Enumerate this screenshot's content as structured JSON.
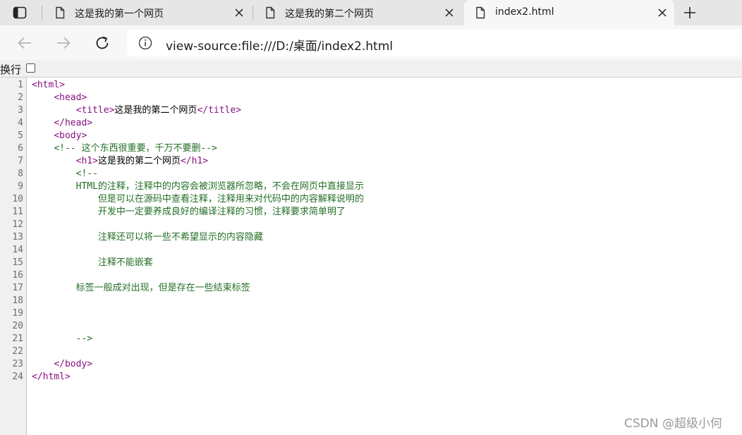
{
  "tabs": [
    {
      "title": "这是我的第一个网页",
      "active": false
    },
    {
      "title": "这是我的第二个网页",
      "active": false
    },
    {
      "title": "index2.html",
      "active": true
    }
  ],
  "address": {
    "url": "view-source:file:///D:/桌面/index2.html"
  },
  "wrap": {
    "label": "换行",
    "checked": false
  },
  "source": {
    "line_numbers": [
      "1",
      "2",
      "3",
      "4",
      "5",
      "6",
      "7",
      "8",
      "9",
      "10",
      "11",
      "12",
      "13",
      "14",
      "15",
      "16",
      "17",
      "18",
      "19",
      "20",
      "21",
      "22",
      "23",
      "24"
    ],
    "lines": [
      [
        {
          "t": "<html>",
          "c": "tag"
        }
      ],
      [
        {
          "t": "    ",
          "c": "txt"
        },
        {
          "t": "<head>",
          "c": "tag"
        }
      ],
      [
        {
          "t": "        ",
          "c": "txt"
        },
        {
          "t": "<title>",
          "c": "tag"
        },
        {
          "t": "这是我的第二个网页",
          "c": "txt"
        },
        {
          "t": "</title>",
          "c": "tag"
        }
      ],
      [
        {
          "t": "    ",
          "c": "txt"
        },
        {
          "t": "</head>",
          "c": "tag"
        }
      ],
      [
        {
          "t": "    ",
          "c": "txt"
        },
        {
          "t": "<body>",
          "c": "tag"
        }
      ],
      [
        {
          "t": "    ",
          "c": "txt"
        },
        {
          "t": "<!-- 这个东西很重要，千万不要删-->",
          "c": "cmt"
        }
      ],
      [
        {
          "t": "        ",
          "c": "txt"
        },
        {
          "t": "<h1>",
          "c": "tag"
        },
        {
          "t": "这是我的第二个网页",
          "c": "txt"
        },
        {
          "t": "</h1>",
          "c": "tag"
        }
      ],
      [
        {
          "t": "        ",
          "c": "txt"
        },
        {
          "t": "<!--",
          "c": "cmt"
        }
      ],
      [
        {
          "t": "        ",
          "c": "txt"
        },
        {
          "t": "HTML的注释，注释中的内容会被浏览器所忽略，不会在网页中直接显示",
          "c": "cmt"
        }
      ],
      [
        {
          "t": "            ",
          "c": "txt"
        },
        {
          "t": "但是可以在源码中查看注释，注释用来对代码中的内容解释说明的",
          "c": "cmt"
        }
      ],
      [
        {
          "t": "            ",
          "c": "txt"
        },
        {
          "t": "开发中一定要养成良好的编译注释的习惯，注释要求简单明了",
          "c": "cmt"
        }
      ],
      [],
      [
        {
          "t": "            ",
          "c": "txt"
        },
        {
          "t": "注释还可以将一些不希望显示的内容隐藏",
          "c": "cmt"
        }
      ],
      [],
      [
        {
          "t": "            ",
          "c": "txt"
        },
        {
          "t": "注释不能嵌套",
          "c": "cmt"
        }
      ],
      [],
      [
        {
          "t": "        ",
          "c": "txt"
        },
        {
          "t": "标签一般成对出现，但是存在一些结束标签",
          "c": "cmt"
        }
      ],
      [],
      [],
      [],
      [
        {
          "t": "        ",
          "c": "txt"
        },
        {
          "t": "-->",
          "c": "cmt"
        }
      ],
      [],
      [
        {
          "t": "    ",
          "c": "txt"
        },
        {
          "t": "</body>",
          "c": "tag"
        }
      ],
      [
        {
          "t": "</html>",
          "c": "tag"
        }
      ]
    ]
  },
  "watermark": "CSDN @超级小何",
  "icons": {
    "tab_actions": "tab-actions-icon",
    "document": "document-icon",
    "close": "close-icon",
    "new_tab": "plus-icon",
    "back": "back-arrow-icon",
    "forward": "forward-arrow-icon",
    "refresh": "refresh-icon",
    "site_info": "info-icon"
  },
  "colors": {
    "tag": "#881280",
    "comment": "#236e25",
    "text": "#000000",
    "line_number": "#6d6d6d"
  }
}
